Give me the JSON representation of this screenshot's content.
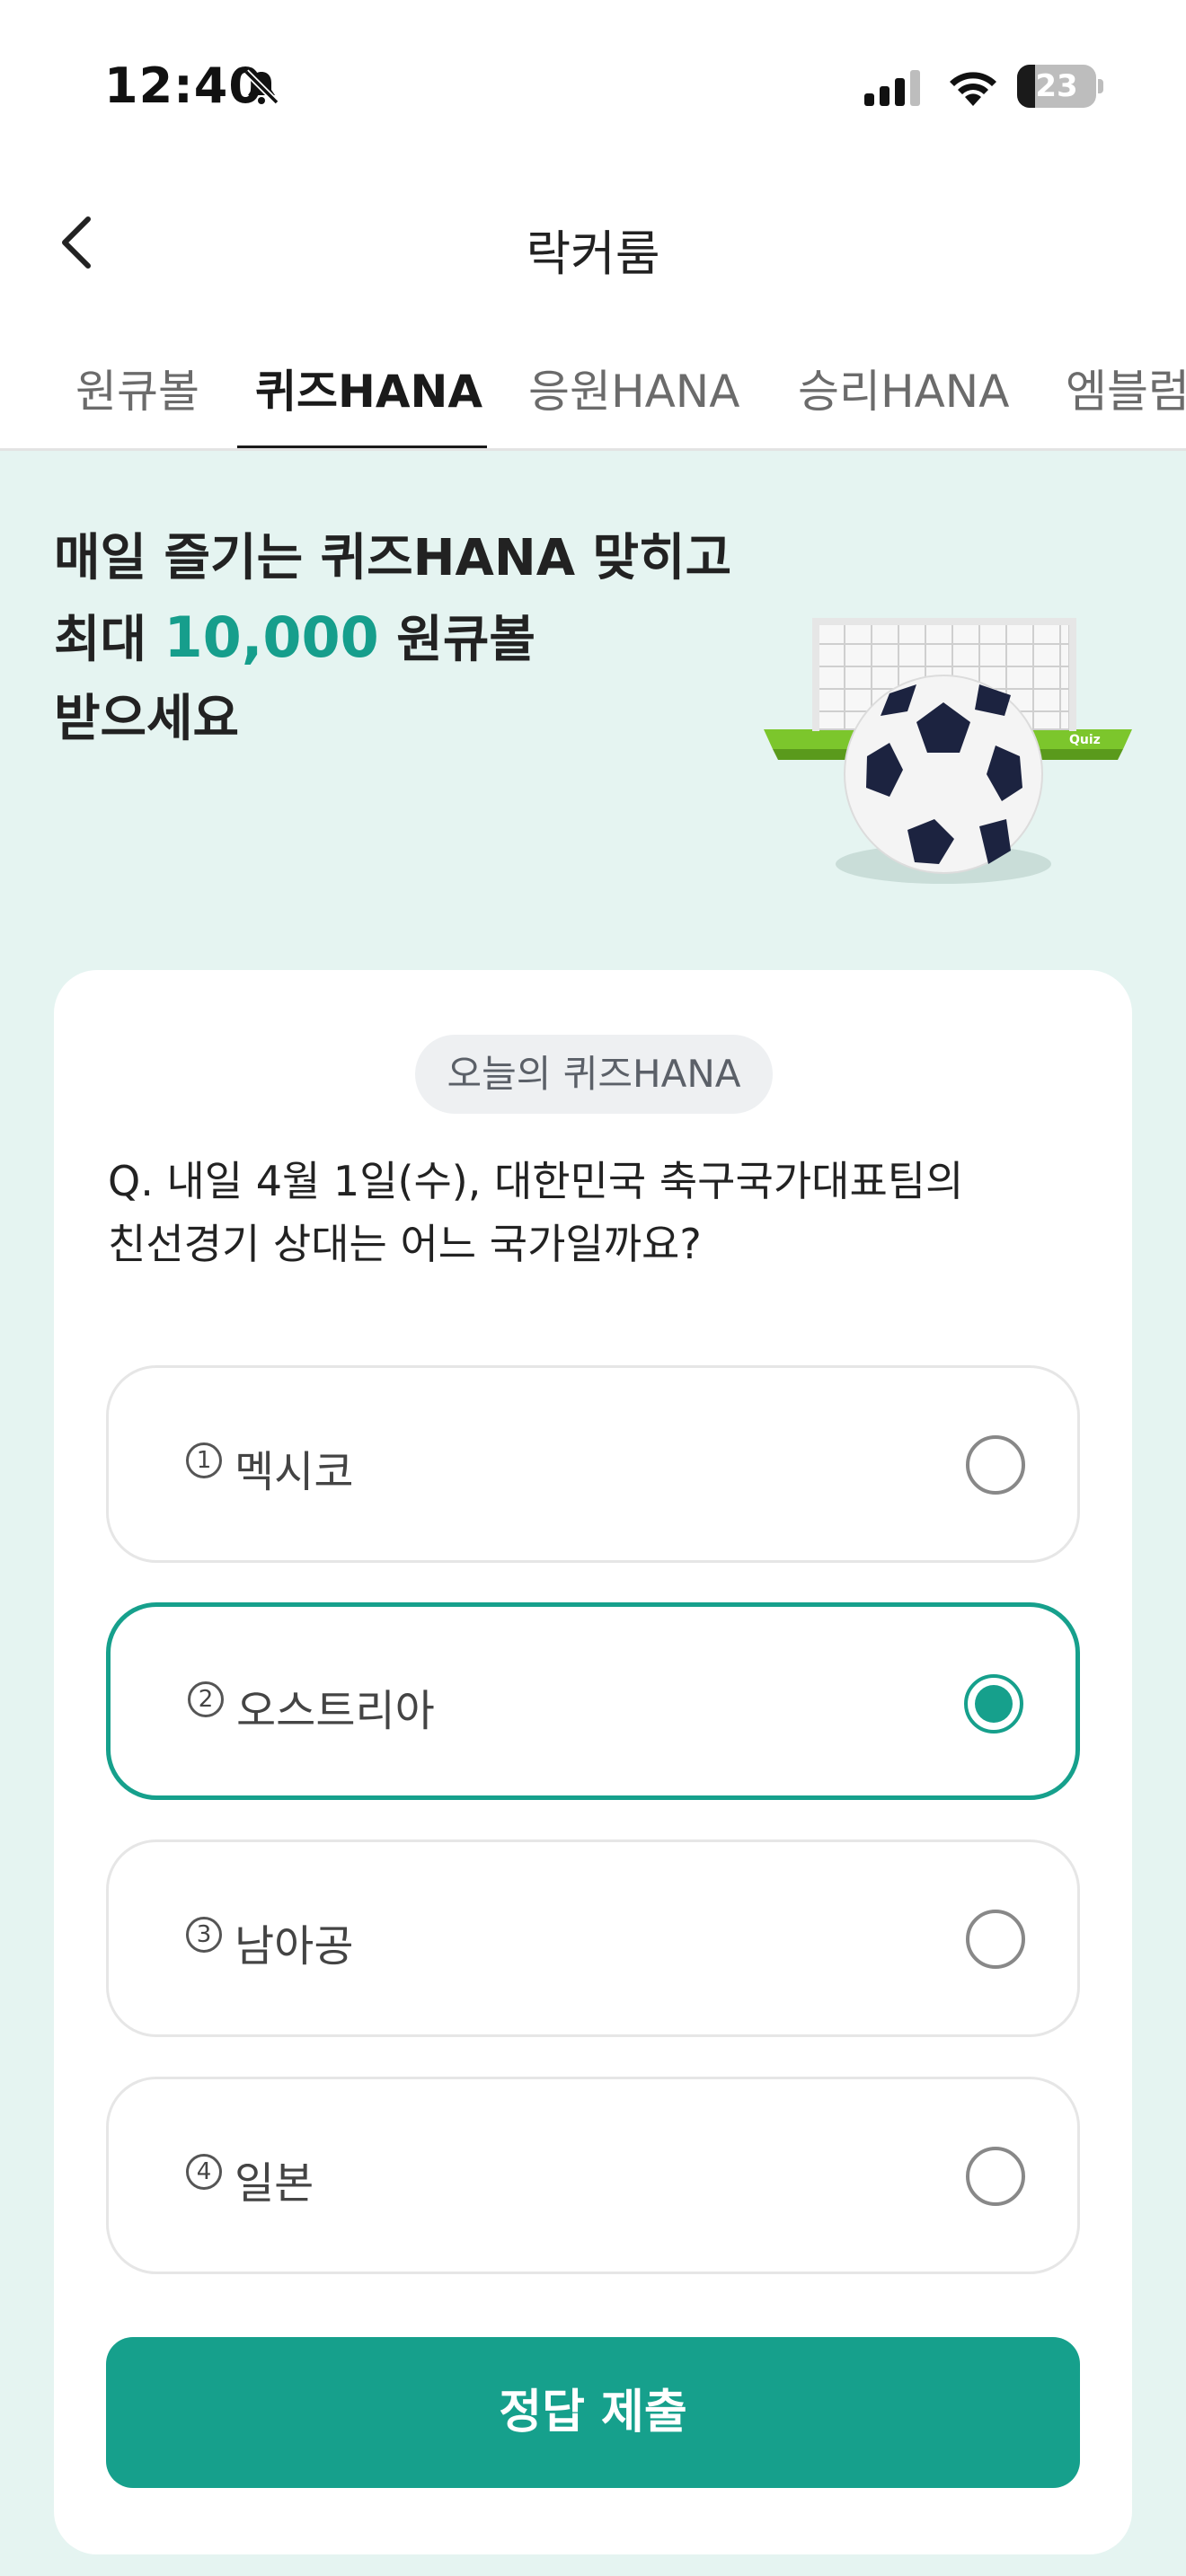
{
  "status_bar": {
    "time": "12:40",
    "battery": "23",
    "battery_level": 0.23
  },
  "header": {
    "title": "락커룸"
  },
  "tabs": [
    {
      "label": "원큐볼",
      "active": false
    },
    {
      "label": "퀴즈HANA",
      "active": true
    },
    {
      "label": "응원HANA",
      "active": false
    },
    {
      "label": "승리HANA",
      "active": false
    },
    {
      "label": "엠블럼",
      "active": false
    }
  ],
  "hero": {
    "line1": "매일 즐기는 퀴즈HANA 맞히고",
    "line2_prefix": "최대 ",
    "line2_amount": "10,000",
    "line2_suffix": " 원큐볼",
    "line3": "받으세요",
    "illustration_label": "Quiz",
    "accent_color": "#169e8c"
  },
  "quiz": {
    "badge": "오늘의 퀴즈HANA",
    "question_line1": "Q. 내일 4월 1일(수), 대한민국 축구국가대표팀의",
    "question_line2": "친선경기 상대는 어느 국가일까요?",
    "options": [
      {
        "number": "1",
        "label": "멕시코",
        "selected": false
      },
      {
        "number": "2",
        "label": "오스트리아",
        "selected": true
      },
      {
        "number": "3",
        "label": "남아공",
        "selected": false
      },
      {
        "number": "4",
        "label": "일본",
        "selected": false
      }
    ],
    "submit_label": "정답 제출"
  },
  "colors": {
    "primary": "#16a08c",
    "hero_bg": "#e5f4f1"
  }
}
